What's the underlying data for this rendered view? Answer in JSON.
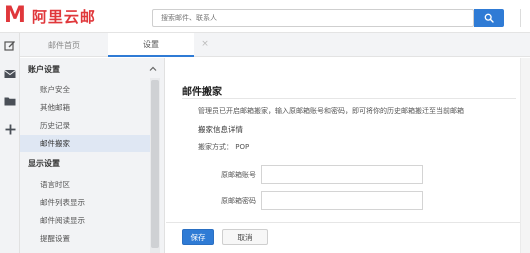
{
  "header": {
    "logo_letter": "M",
    "logo_text": "阿里云邮",
    "search_placeholder": "搜索邮件、联系人"
  },
  "tabs": [
    {
      "label": "邮件首页"
    },
    {
      "label": "设置"
    }
  ],
  "tab_close": "×",
  "sidebar": {
    "section1_title": "账户设置",
    "section1_items": [
      {
        "label": "账户安全"
      },
      {
        "label": "其他邮箱"
      },
      {
        "label": "历史记录"
      },
      {
        "label": "邮件搬家"
      }
    ],
    "section2_title": "显示设置",
    "section2_items": [
      {
        "label": "语言时区"
      },
      {
        "label": "邮件列表显示"
      },
      {
        "label": "邮件阅读显示"
      },
      {
        "label": "提醒设置"
      }
    ]
  },
  "main": {
    "title": "邮件搬家",
    "description": "管理员已开启邮箱搬家，输入原邮箱账号和密码，即可将你的历史邮箱搬迁至当前邮箱",
    "info_title": "搬家信息详情",
    "method": "搬家方式： POP",
    "account_label": "原邮箱账号",
    "password_label": "原邮箱密码",
    "account_value": "",
    "password_value": "",
    "save_label": "保存",
    "cancel_label": "取消"
  },
  "colors": {
    "brand": "#e0373b",
    "accent": "#2f7bd5"
  }
}
